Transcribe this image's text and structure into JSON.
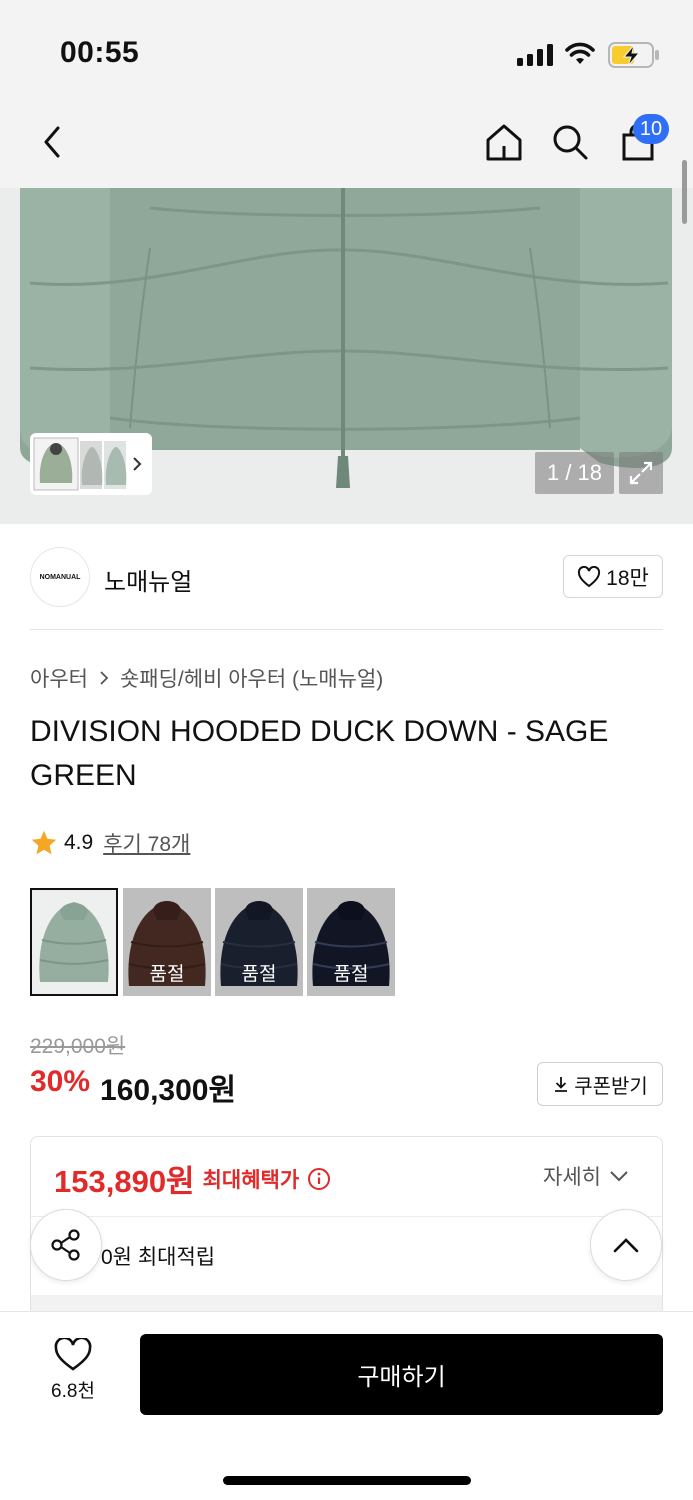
{
  "status_bar": {
    "time": "00:55"
  },
  "header": {
    "cart_count": "10"
  },
  "gallery": {
    "counter": "1 / 18"
  },
  "brand": {
    "logo_text": "NOMANUAL",
    "name": "노매뉴얼",
    "likes": "18만"
  },
  "breadcrumb": {
    "category": "아우터",
    "subcategory": "숏패딩/헤비 아우터 (노매뉴얼)"
  },
  "product": {
    "title": "DIVISION HOODED DUCK DOWN - SAGE GREEN",
    "rating": "4.9",
    "review_link": "후기 78개"
  },
  "swatches": [
    {
      "color": "sage",
      "hex": "#95ae9f",
      "sold_label": ""
    },
    {
      "color": "brown",
      "hex": "#4d2e27",
      "sold_label": "품절"
    },
    {
      "color": "navy",
      "hex": "#1d2434",
      "sold_label": "품절"
    },
    {
      "color": "black",
      "hex": "#14192a",
      "sold_label": "품절"
    }
  ],
  "pricing": {
    "original_price": "229,000원",
    "discount": "30%",
    "sale_price": "160,300원",
    "coupon_label": "쿠폰받기",
    "max_benefit_price": "153,890원",
    "max_benefit_label": "최대혜택가",
    "detail_label": "자세히",
    "points_text": "0원 최대적립"
  },
  "bottom_bar": {
    "wish_count": "6.8천",
    "buy_label": "구매하기"
  },
  "colors": {
    "accent_red": "#e12a2a",
    "badge_blue": "#2f6ef7",
    "star": "#f5a623"
  }
}
